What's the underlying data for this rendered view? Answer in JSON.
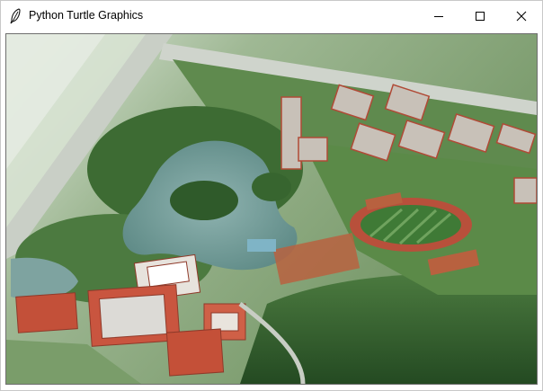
{
  "window": {
    "title": "Python Turtle Graphics",
    "icon": "feather-icon",
    "controls": [
      "minimize-icon",
      "maximize-icon",
      "close-icon"
    ]
  },
  "canvas": {
    "content": "image",
    "colors": {
      "lake": "#6f9a9a",
      "forest": "#2f5a2c",
      "roof": "#c9553f",
      "track": "#b8503b",
      "field": "#3f7a36"
    }
  }
}
